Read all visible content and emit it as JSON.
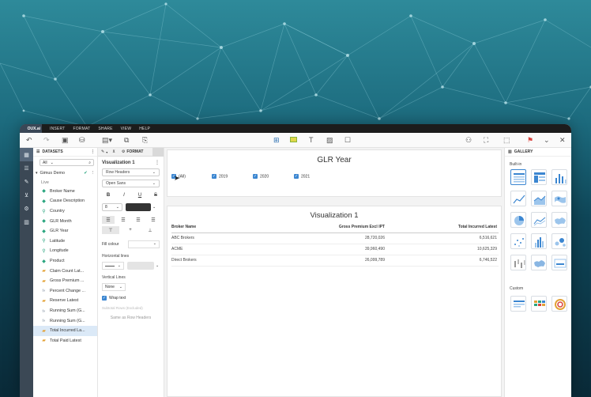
{
  "brand": "OUX.ai",
  "menu": [
    "INSERT",
    "FORMAT",
    "SHARE",
    "VIEW",
    "HELP"
  ],
  "datasets": {
    "title": "DATASETS",
    "filter_value": "All",
    "dataset_name": "Gimus Demo",
    "status": "Live",
    "fields": [
      {
        "label": "Broker Name",
        "kind": "dimension"
      },
      {
        "label": "Cause Description",
        "kind": "dimension"
      },
      {
        "label": "Country",
        "kind": "geo"
      },
      {
        "label": "GLR Month",
        "kind": "dimension"
      },
      {
        "label": "GLR Year",
        "kind": "dimension"
      },
      {
        "label": "Latitude",
        "kind": "geo"
      },
      {
        "label": "Longitude",
        "kind": "geo"
      },
      {
        "label": "Product",
        "kind": "dimension"
      },
      {
        "label": "Claim Count Lat...",
        "kind": "measure"
      },
      {
        "label": "Gross Premium ...",
        "kind": "measure"
      },
      {
        "label": "Percent Change ...",
        "kind": "calc"
      },
      {
        "label": "Reserve Latest",
        "kind": "measure"
      },
      {
        "label": "Running Sum (G...",
        "kind": "calc"
      },
      {
        "label": "Running Sum (G...",
        "kind": "calc"
      },
      {
        "label": "Total Incurred La...",
        "kind": "measure",
        "selected": true
      },
      {
        "label": "Total Paid Latest",
        "kind": "measure"
      }
    ]
  },
  "format": {
    "tab_label": "FORMAT",
    "title": "Visualization 1",
    "row_headers": "Row Headers",
    "font": "Open Sans",
    "font_size": "8",
    "fill_colour": "Fill colour",
    "horizontal_lines": "Horizontal lines",
    "vertical_lines": "Vertical Lines",
    "vertical_value": "None",
    "wrap_text": "Wrap text",
    "subtotal_label": "Subtotal Rows (Excluded)",
    "same_as_row_headers": "Same as Row Headers"
  },
  "filter": {
    "title": "GLR Year",
    "options": [
      "(All)",
      "2019",
      "2020",
      "2021"
    ]
  },
  "visualization": {
    "title": "Visualization 1",
    "columns": [
      "Broker Name",
      "Gross Premium Excl IPT",
      "Total Incurred Latest"
    ],
    "rows": [
      [
        "ABC Brokers",
        "28,720,026",
        "6,516,621"
      ],
      [
        "ACME",
        "39,960,490",
        "10,625,329"
      ],
      [
        "Direct Brokers",
        "26,099,789",
        "6,746,522"
      ]
    ]
  },
  "gallery": {
    "title": "GALLERY",
    "builtin_label": "Built-in",
    "custom_label": "Custom"
  },
  "colors": {
    "accent": "#3b86d1",
    "rail": "#3b4855",
    "dimension": "#2aa57f",
    "measure": "#e3a236"
  }
}
